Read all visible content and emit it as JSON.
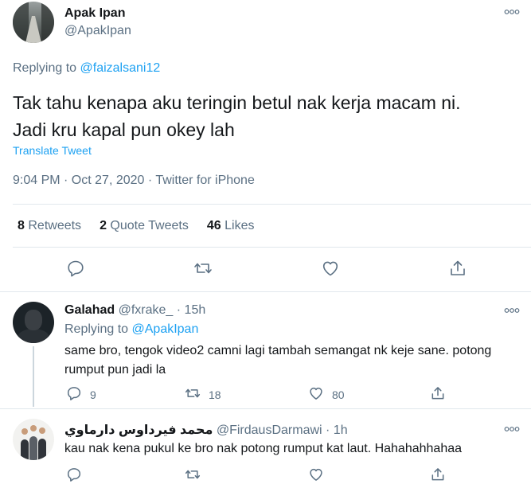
{
  "main_tweet": {
    "author_name": "Apak Ipan",
    "author_handle": "@ApakIpan",
    "replying_prefix": "Replying to",
    "replying_to": "@faizalsani12",
    "text_line1": "Tak tahu kenapa aku teringin betul nak kerja macam ni.",
    "text_line2": "Jadi kru kapal pun okey lah",
    "translate_label": "Translate Tweet",
    "timestamp": "9:04 PM · Oct 27, 2020 · Twitter for iPhone",
    "stats": {
      "retweets_count": "8",
      "retweets_label": "Retweets",
      "quotes_count": "2",
      "quotes_label": "Quote Tweets",
      "likes_count": "46",
      "likes_label": "Likes"
    }
  },
  "replies": [
    {
      "name": "Galahad",
      "handle": "@fxrake_",
      "time": "· 15h",
      "replying_prefix": "Replying to",
      "replying_to": "@ApakIpan",
      "text_line1": "same bro, tengok video2 camni lagi tambah semangat nk keje sane. potong",
      "text_line2": "rumput pun jadi la",
      "reply_count": "9",
      "retweet_count": "18",
      "like_count": "80"
    },
    {
      "name": "محمد فيرداوس دارماوي",
      "handle": "@FirdausDarmawi",
      "time": "· 1h",
      "text_line1": "kau nak kena pukul ke bro nak potong rumput kat laut. Hahahahhahaa"
    }
  ],
  "icons": {
    "reply": "reply-icon",
    "retweet": "retweet-icon",
    "like": "heart-icon",
    "share": "share-icon",
    "more": "more-icon"
  },
  "colors": {
    "accent": "#1da1f2",
    "text": "#14171a",
    "secondary": "#5b7083",
    "border": "#e1e8ed"
  }
}
